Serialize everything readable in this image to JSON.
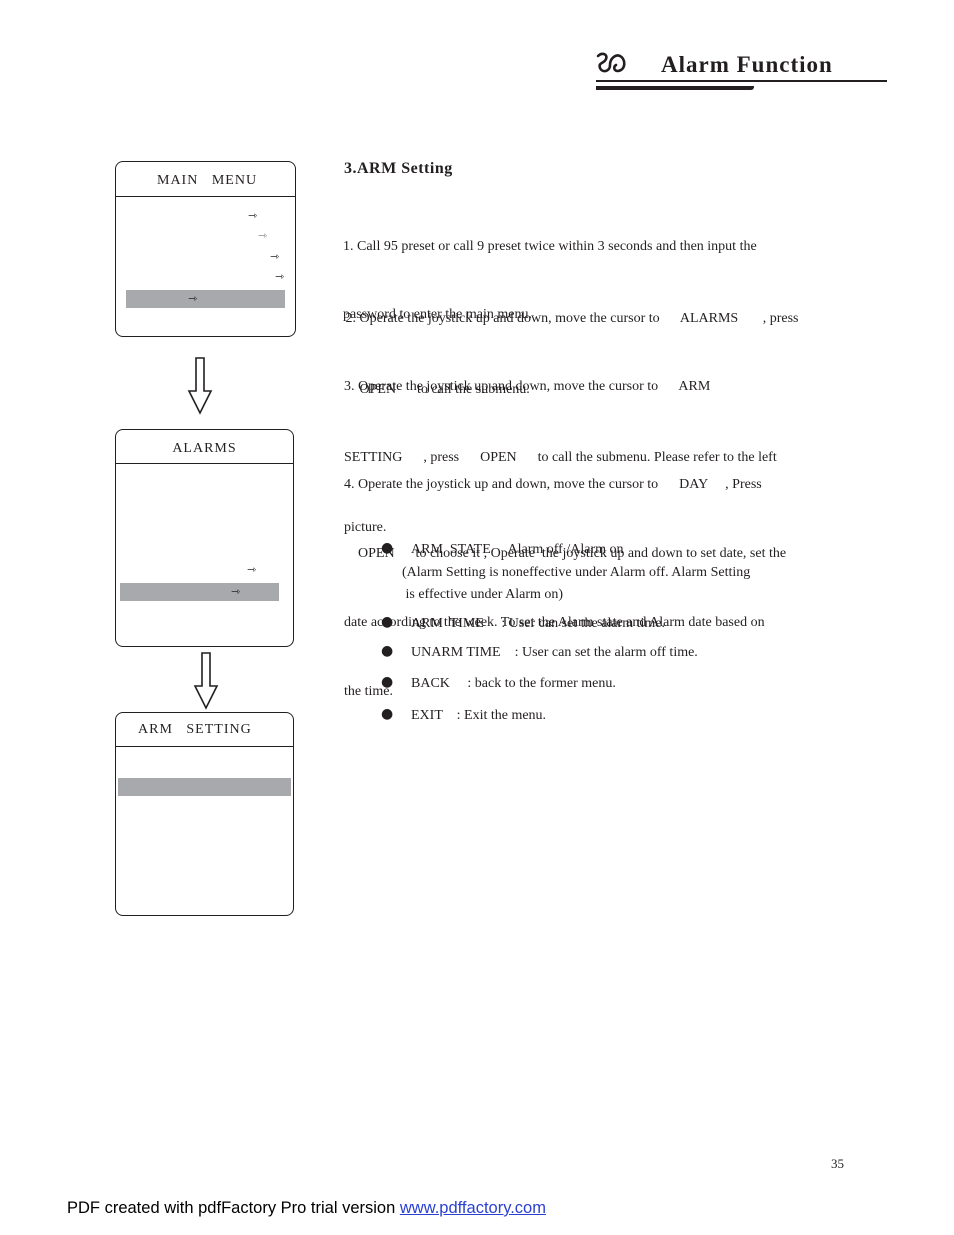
{
  "header": {
    "logo_glyph": "ℬ",
    "title": "Alarm Function"
  },
  "menus": {
    "main_menu": {
      "title": "MAIN   MENU",
      "arrow_rows": 5,
      "highlight_row": 5
    },
    "alarms": {
      "title": "ALARMS",
      "arrow_rows": 2,
      "highlight_row": 2
    },
    "arm_setting": {
      "title": "ARM   SETTING",
      "highlight_row": 2
    }
  },
  "icons": {
    "submenu_arrow": "⇾",
    "down_arrow": "down-arrow-icon",
    "bullet": "●"
  },
  "section": {
    "title": "3.ARM  Setting",
    "steps": [
      {
        "lines": [
          "1. Call 95 preset or call 9 preset twice within 3 seconds and then input the",
          "password to enter the main menu."
        ]
      },
      {
        "lines": [
          " 2. Operate the joystick up and down, move the cursor to      ALARMS       , press",
          "     OPEN      to call the submenu."
        ]
      },
      {
        "lines": [
          "3. Operate the joystick up and down, move the cursor to      ARM",
          "SETTING      , press      OPEN      to call the submenu. Please refer to the left",
          "picture."
        ]
      },
      {
        "lines": [
          "4. Operate the joystick up and down, move the cursor to      DAY     , Press",
          "    OPEN      to choose it , Operate  the joystick up and down to set date, set the",
          "date according to the week. To set the Alarm state and Alarm date based on",
          "the time."
        ]
      }
    ],
    "bullets": [
      {
        "text": "ARM  STATE     Alarm off /Alarm on",
        "note": [
          "(Alarm Setting is noneffective under Alarm off. Alarm Setting",
          " is effective under Alarm on)"
        ]
      },
      {
        "text": "ARM  TIME     : User can set the alarm time."
      },
      {
        "text": "UNARM TIME    : User can set the alarm off time."
      },
      {
        "text": "BACK     : back to the former menu."
      },
      {
        "text": "EXIT    : Exit the menu."
      }
    ]
  },
  "page_number": "35",
  "footer": {
    "text": "PDF created with pdfFactory Pro trial version ",
    "link_text": "www.pdffactory.com"
  }
}
